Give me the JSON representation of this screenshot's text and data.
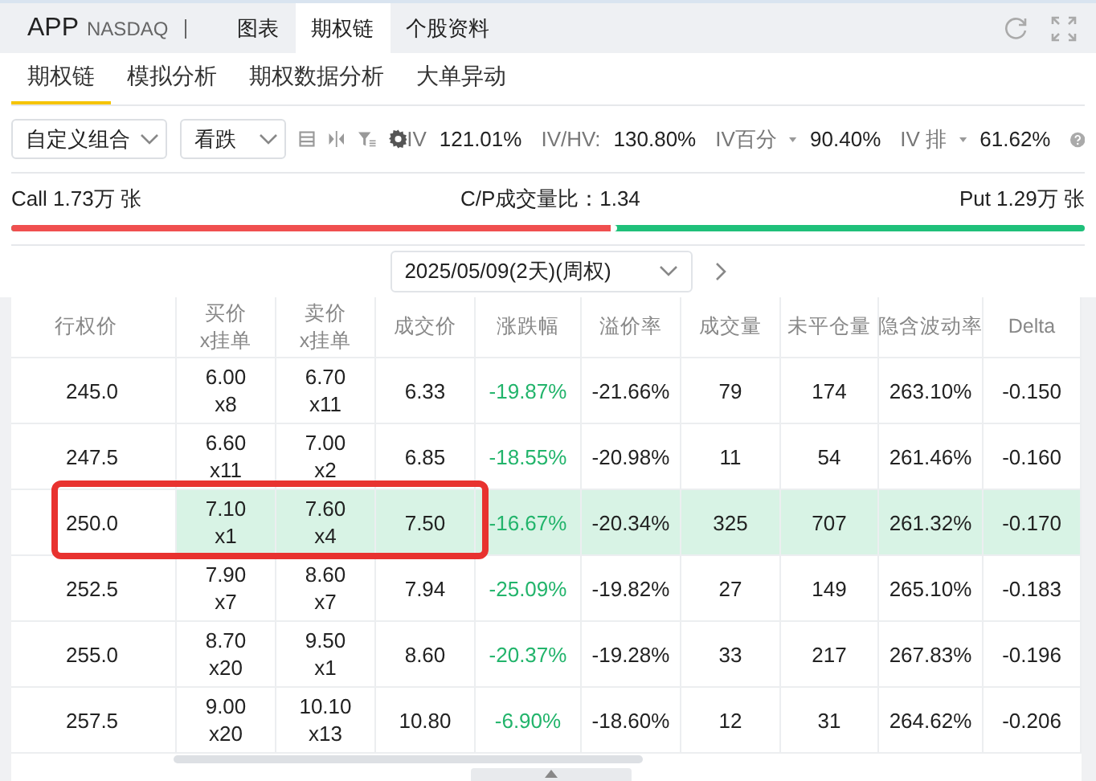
{
  "header": {
    "symbol": "APP",
    "exchange": "NASDAQ",
    "tabs": [
      {
        "label": "图表",
        "selected": false
      },
      {
        "label": "期权链",
        "selected": true
      },
      {
        "label": "个股资料",
        "selected": false
      }
    ]
  },
  "subtabs": [
    {
      "label": "期权链",
      "selected": true
    },
    {
      "label": "模拟分析",
      "selected": false
    },
    {
      "label": "期权数据分析",
      "selected": false
    },
    {
      "label": "大单异动",
      "selected": false
    }
  ],
  "toolbar": {
    "combo": "自定义组合",
    "side": "看跌",
    "iv_label": "IV",
    "iv": "121.01%",
    "ivhv_label": "IV/HV:",
    "ivhv": "130.80%",
    "ivpct_label": "IV百分",
    "ivpct": "90.40%",
    "ivrank_label": "IV 排",
    "ivrank": "61.62%"
  },
  "volume": {
    "call": "Call 1.73万 张",
    "ratio": "C/P成交量比：1.34",
    "put": "Put 1.29万 张",
    "level": 0.565
  },
  "expiry": "2025/05/09(2天)(周权)",
  "table": {
    "columns": [
      "行权价",
      "买价\nx挂单",
      "卖价\nx挂单",
      "成交价",
      "涨跌幅",
      "溢价率",
      "成交量",
      "未平仓量",
      "隐含波动率",
      "Delta"
    ],
    "rows": [
      {
        "selected": false,
        "cells": [
          "245.0",
          "6.00\nx8",
          "6.70\nx11",
          "6.33",
          "-19.87%",
          "-21.66%",
          "79",
          "174",
          "263.10%",
          "-0.150"
        ]
      },
      {
        "selected": false,
        "cells": [
          "247.5",
          "6.60\nx11",
          "7.00\nx2",
          "6.85",
          "-18.55%",
          "-20.98%",
          "11",
          "54",
          "261.46%",
          "-0.160"
        ]
      },
      {
        "selected": true,
        "outlined": true,
        "cells": [
          "250.0",
          "7.10\nx1",
          "7.60\nx4",
          "7.50",
          "-16.67%",
          "-20.34%",
          "325",
          "707",
          "261.32%",
          "-0.170"
        ]
      },
      {
        "selected": false,
        "cells": [
          "252.5",
          "7.90\nx7",
          "8.60\nx7",
          "7.94",
          "-25.09%",
          "-19.82%",
          "27",
          "149",
          "265.10%",
          "-0.183"
        ]
      },
      {
        "selected": false,
        "cells": [
          "255.0",
          "8.70\nx20",
          "9.50\nx1",
          "8.60",
          "-20.37%",
          "-19.28%",
          "33",
          "217",
          "267.83%",
          "-0.196"
        ]
      },
      {
        "selected": false,
        "cells": [
          "257.5",
          "9.00\nx20",
          "10.10\nx13",
          "10.80",
          "-6.90%",
          "-18.60%",
          "12",
          "31",
          "264.62%",
          "-0.206"
        ]
      }
    ]
  }
}
